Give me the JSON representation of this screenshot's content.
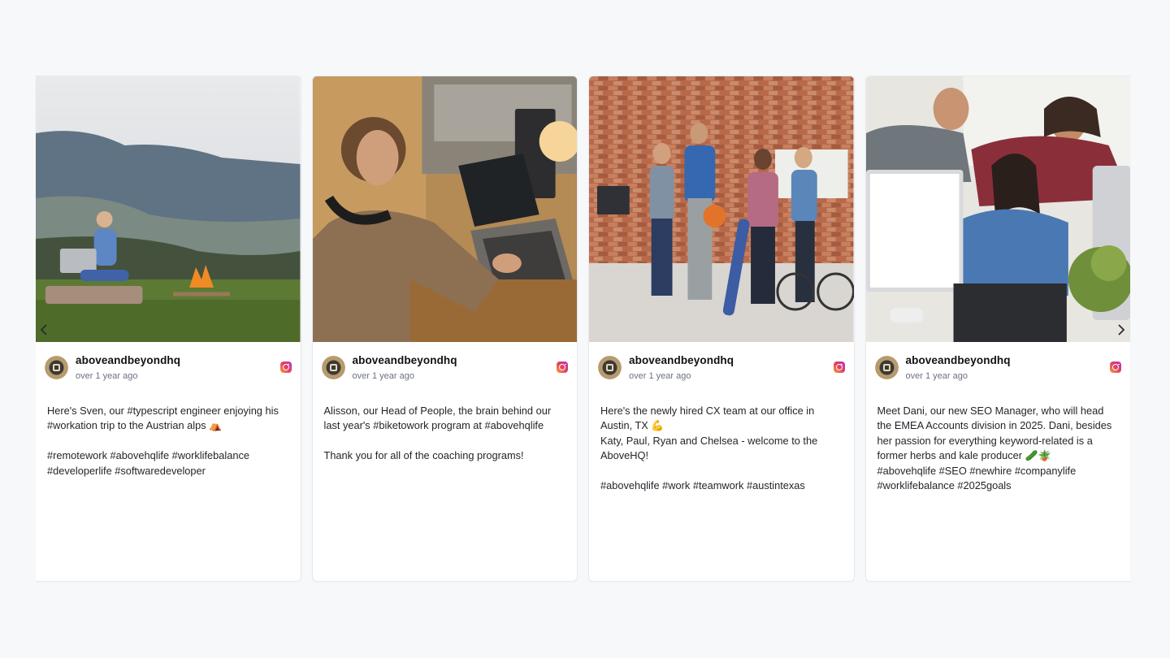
{
  "feed": {
    "posts": [
      {
        "handle": "aboveandbeyondhq",
        "time": "over 1 year ago",
        "caption": "Here's Sven, our #typescript engineer enjoying his #workation trip to the Austrian alps ⛺\n\n#remotework #abovehqlife #worklifebalance #developerlife #softwaredeveloper",
        "photo_desc": "mountain-camp-laptop-photo"
      },
      {
        "handle": "aboveandbeyondhq",
        "time": "over 1 year ago",
        "caption": "Alisson, our Head of People, the brain behind our last year's #biketowork program at #abovehqlife\n\nThank you for all of the coaching programs!",
        "photo_desc": "woman-at-laptop-photo"
      },
      {
        "handle": "aboveandbeyondhq",
        "time": "over 1 year ago",
        "caption": "Here's the newly hired CX team at our office in Austin, TX 💪\nKaty, Paul, Ryan and Chelsea - welcome to the AboveHQ!\n\n#abovehqlife #work #teamwork #austintexas",
        "photo_desc": "team-office-photo"
      },
      {
        "handle": "aboveandbeyondhq",
        "time": "over 1 year ago",
        "caption": "Meet Dani, our new SEO Manager, who will head the EMEA Accounts division in 2025. Dani, besides her passion for everything keyword-related is a former herbs and kale producer 🥒🪴\n#abovehqlife #SEO #newhire #companylife #worklifebalance #2025goals",
        "photo_desc": "team-computer-photo"
      }
    ],
    "prev_label": "‹",
    "next_label": "›"
  },
  "icons": {
    "platform": "instagram-icon",
    "prev": "chevron-left-icon",
    "next": "chevron-right-icon"
  },
  "colors": {
    "background": "#f7f8fa",
    "card": "#ffffff",
    "text": "#1f2328",
    "muted": "#6b7280"
  }
}
